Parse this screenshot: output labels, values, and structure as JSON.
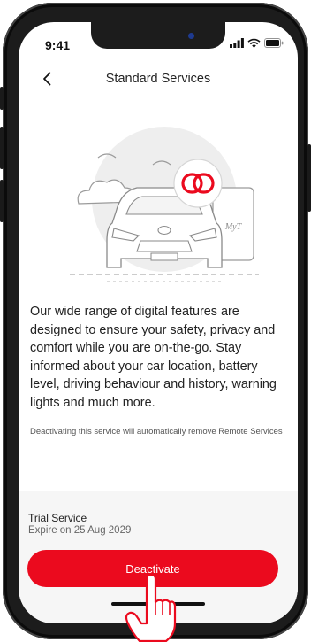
{
  "status_bar": {
    "time": "9:41"
  },
  "header": {
    "title": "Standard Services"
  },
  "illustration": {
    "badge_text": "MyT"
  },
  "content": {
    "description": "Our wide range of digital features are designed to ensure your safety, privacy and comfort while you are on-the-go. Stay informed about your car location, battery level, driving behaviour and history, warning lights and much more.",
    "note": "Deactivating this service will automatically remove Remote Services"
  },
  "footer": {
    "trial_label": "Trial Service",
    "expire_text": "Expire on 25 Aug 2029",
    "deactivate_label": "Deactivate"
  },
  "colors": {
    "accent": "#eb0a1e",
    "footer_bg": "#f6f6f6"
  },
  "icons": [
    "back-chevron-icon",
    "signal-icon",
    "wifi-icon",
    "battery-icon",
    "connected-link-icon",
    "pointing-hand-icon"
  ]
}
